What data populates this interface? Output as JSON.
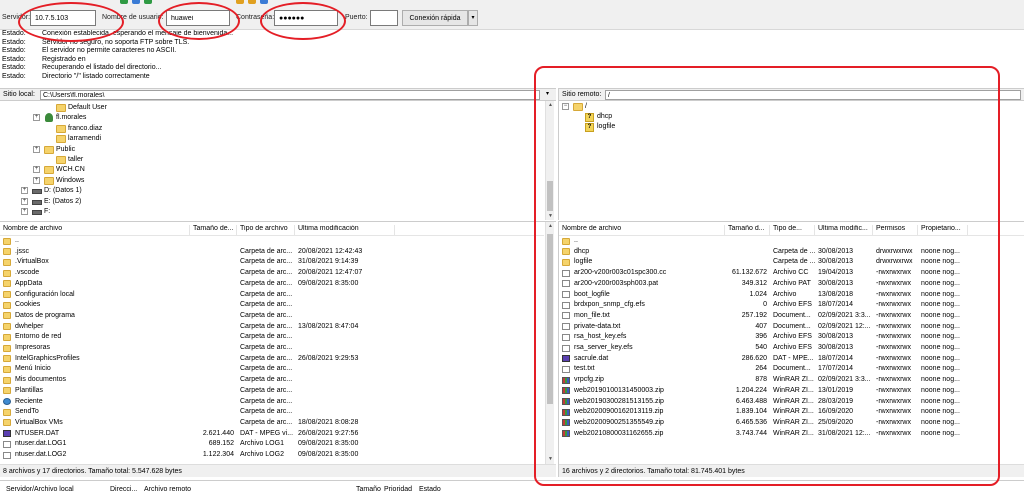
{
  "quickconnect": {
    "host_label": "Servidor:",
    "host_value": "10.7.5.103",
    "user_label": "Nombre de usuario:",
    "user_value": "huawei",
    "pass_label": "Contraseña:",
    "pass_value": "●●●●●●",
    "port_label": "Puerto:",
    "port_value": "",
    "connect_label": "Conexión rápida",
    "dropdown_label": "▾"
  },
  "log": [
    {
      "label": "Estado:",
      "msg": "Conexión establecida, esperando el mensaje de bienvenida..."
    },
    {
      "label": "Estado:",
      "msg": "Servidor no seguro, no soporta FTP sobre TLS."
    },
    {
      "label": "Estado:",
      "msg": "El servidor no permite caracteres no ASCII."
    },
    {
      "label": "Estado:",
      "msg": "Registrado en"
    },
    {
      "label": "Estado:",
      "msg": "Recuperando el listado del directorio..."
    },
    {
      "label": "Estado:",
      "msg": "Directorio \"/\" listado correctamente"
    }
  ],
  "local": {
    "path_label": "Sitio local:",
    "path_value": "C:\\Users\\fl.morales\\",
    "tree": [
      {
        "label": "Default User",
        "icon": "folder"
      },
      {
        "label": "fl.morales",
        "icon": "user"
      },
      {
        "label": "franco.diaz",
        "icon": "folder"
      },
      {
        "label": "larramendi",
        "icon": "folder"
      },
      {
        "label": "Public",
        "icon": "folder"
      },
      {
        "label": "taller",
        "icon": "folder"
      },
      {
        "label": "WCH.CN",
        "icon": "folder"
      },
      {
        "label": "Windows",
        "icon": "folder"
      },
      {
        "label": "D: (Datos 1)",
        "icon": "drive"
      },
      {
        "label": "E: (Datos 2)",
        "icon": "drive"
      },
      {
        "label": "F:",
        "icon": "drive"
      }
    ],
    "columns": [
      "Nombre de archivo",
      "Tamaño de...",
      "Tipo de archivo",
      "Última modificación"
    ],
    "files": [
      {
        "name": "..",
        "size": "",
        "type": "",
        "modified": "",
        "icon": "folder"
      },
      {
        "name": ".jssc",
        "size": "",
        "type": "Carpeta de arc...",
        "modified": "20/08/2021 12:42:43",
        "icon": "folder"
      },
      {
        "name": ".VirtualBox",
        "size": "",
        "type": "Carpeta de arc...",
        "modified": "31/08/2021 9:14:39",
        "icon": "folder"
      },
      {
        "name": ".vscode",
        "size": "",
        "type": "Carpeta de arc...",
        "modified": "20/08/2021 12:47:07",
        "icon": "folder"
      },
      {
        "name": "AppData",
        "size": "",
        "type": "Carpeta de arc...",
        "modified": "09/08/2021 8:35:00",
        "icon": "folder"
      },
      {
        "name": "Configuración local",
        "size": "",
        "type": "Carpeta de arc...",
        "modified": "",
        "icon": "folder"
      },
      {
        "name": "Cookies",
        "size": "",
        "type": "Carpeta de arc...",
        "modified": "",
        "icon": "folder"
      },
      {
        "name": "Datos de programa",
        "size": "",
        "type": "Carpeta de arc...",
        "modified": "",
        "icon": "folder"
      },
      {
        "name": "dwhelper",
        "size": "",
        "type": "Carpeta de arc...",
        "modified": "13/08/2021 8:47:04",
        "icon": "folder"
      },
      {
        "name": "Entorno de red",
        "size": "",
        "type": "Carpeta de arc...",
        "modified": "",
        "icon": "folder"
      },
      {
        "name": "Impresoras",
        "size": "",
        "type": "Carpeta de arc...",
        "modified": "",
        "icon": "folder"
      },
      {
        "name": "IntelGraphicsProfiles",
        "size": "",
        "type": "Carpeta de arc...",
        "modified": "26/08/2021 9:29:53",
        "icon": "folder"
      },
      {
        "name": "Menú Inicio",
        "size": "",
        "type": "Carpeta de arc...",
        "modified": "",
        "icon": "folder"
      },
      {
        "name": "Mis documentos",
        "size": "",
        "type": "Carpeta de arc...",
        "modified": "",
        "icon": "folder"
      },
      {
        "name": "Plantillas",
        "size": "",
        "type": "Carpeta de arc...",
        "modified": "",
        "icon": "folder"
      },
      {
        "name": "Reciente",
        "size": "",
        "type": "Carpeta de arc...",
        "modified": "",
        "icon": "globe"
      },
      {
        "name": "SendTo",
        "size": "",
        "type": "Carpeta de arc...",
        "modified": "",
        "icon": "folder"
      },
      {
        "name": "VirtualBox VMs",
        "size": "",
        "type": "Carpeta de arc...",
        "modified": "18/08/2021 8:08:28",
        "icon": "folder"
      },
      {
        "name": "NTUSER.DAT",
        "size": "2.621.440",
        "type": "DAT - MPEG vi...",
        "modified": "26/08/2021 9:27:56",
        "icon": "media"
      },
      {
        "name": "ntuser.dat.LOG1",
        "size": "689.152",
        "type": "Archivo LOG1",
        "modified": "09/08/2021 8:35:00",
        "icon": "file"
      },
      {
        "name": "ntuser.dat.LOG2",
        "size": "1.122.304",
        "type": "Archivo LOG2",
        "modified": "09/08/2021 8:35:00",
        "icon": "file"
      }
    ],
    "status": "8 archivos y 17 directorios. Tamaño total: 5.547.628 bytes"
  },
  "remote": {
    "path_label": "Sitio remoto:",
    "path_value": "/",
    "tree": [
      {
        "label": "/",
        "icon": "folder"
      },
      {
        "label": "dhcp",
        "icon": "unknown"
      },
      {
        "label": "logfile",
        "icon": "unknown"
      }
    ],
    "columns": [
      "Nombre de archivo",
      "Tamaño d...",
      "Tipo de...",
      "Última modific...",
      "Permisos",
      "Propietario..."
    ],
    "files": [
      {
        "name": "..",
        "size": "",
        "type": "",
        "modified": "",
        "perms": "",
        "owner": "",
        "icon": "folder"
      },
      {
        "name": "dhcp",
        "size": "",
        "type": "Carpeta de ...",
        "modified": "30/08/2013",
        "perms": "drwxrwxrwx",
        "owner": "noone nog...",
        "icon": "folder"
      },
      {
        "name": "logfile",
        "size": "",
        "type": "Carpeta de ...",
        "modified": "30/08/2013",
        "perms": "drwxrwxrwx",
        "owner": "noone nog...",
        "icon": "folder"
      },
      {
        "name": "ar200-v200r003c01spc300.cc",
        "size": "61.132.672",
        "type": "Archivo CC",
        "modified": "19/04/2013",
        "perms": "-rwxrwxrwx",
        "owner": "noone nog...",
        "icon": "file"
      },
      {
        "name": "ar200-v200r003sph003.pat",
        "size": "349.312",
        "type": "Archivo PAT",
        "modified": "30/08/2013",
        "perms": "-rwxrwxrwx",
        "owner": "noone nog...",
        "icon": "file"
      },
      {
        "name": "boot_logfile",
        "size": "1.024",
        "type": "Archivo",
        "modified": "13/08/2018",
        "perms": "-rwxrwxrwx",
        "owner": "noone nog...",
        "icon": "file"
      },
      {
        "name": "brdxpon_snmp_cfg.efs",
        "size": "0",
        "type": "Archivo EFS",
        "modified": "18/07/2014",
        "perms": "-rwxrwxrwx",
        "owner": "noone nog...",
        "icon": "file"
      },
      {
        "name": "mon_file.txt",
        "size": "257.192",
        "type": "Document...",
        "modified": "02/09/2021 3:3...",
        "perms": "-rwxrwxrwx",
        "owner": "noone nog...",
        "icon": "file"
      },
      {
        "name": "private-data.txt",
        "size": "407",
        "type": "Document...",
        "modified": "02/09/2021 12:...",
        "perms": "-rwxrwxrwx",
        "owner": "noone nog...",
        "icon": "file"
      },
      {
        "name": "rsa_host_key.efs",
        "size": "396",
        "type": "Archivo EFS",
        "modified": "30/08/2013",
        "perms": "-rwxrwxrwx",
        "owner": "noone nog...",
        "icon": "file"
      },
      {
        "name": "rsa_server_key.efs",
        "size": "540",
        "type": "Archivo EFS",
        "modified": "30/08/2013",
        "perms": "-rwxrwxrwx",
        "owner": "noone nog...",
        "icon": "file"
      },
      {
        "name": "sacrule.dat",
        "size": "286.620",
        "type": "DAT - MPE...",
        "modified": "18/07/2014",
        "perms": "-rwxrwxrwx",
        "owner": "noone nog...",
        "icon": "media"
      },
      {
        "name": "test.txt",
        "size": "264",
        "type": "Document...",
        "modified": "17/07/2014",
        "perms": "-rwxrwxrwx",
        "owner": "noone nog...",
        "icon": "file"
      },
      {
        "name": "vrpcfg.zip",
        "size": "878",
        "type": "WinRAR ZI...",
        "modified": "02/09/2021 3:3...",
        "perms": "-rwxrwxrwx",
        "owner": "noone nog...",
        "icon": "zip"
      },
      {
        "name": "web20190100131450003.zip",
        "size": "1.204.224",
        "type": "WinRAR ZI...",
        "modified": "13/01/2019",
        "perms": "-rwxrwxrwx",
        "owner": "noone nog...",
        "icon": "zip"
      },
      {
        "name": "web20190300281513155.zip",
        "size": "6.463.488",
        "type": "WinRAR ZI...",
        "modified": "28/03/2019",
        "perms": "-rwxrwxrwx",
        "owner": "noone nog...",
        "icon": "zip"
      },
      {
        "name": "web20200900162013119.zip",
        "size": "1.839.104",
        "type": "WinRAR ZI...",
        "modified": "16/09/2020",
        "perms": "-rwxrwxrwx",
        "owner": "noone nog...",
        "icon": "zip"
      },
      {
        "name": "web20200900251355549.zip",
        "size": "6.465.536",
        "type": "WinRAR ZI...",
        "modified": "25/09/2020",
        "perms": "-rwxrwxrwx",
        "owner": "noone nog...",
        "icon": "zip"
      },
      {
        "name": "web20210800031162655.zip",
        "size": "3.743.744",
        "type": "WinRAR ZI...",
        "modified": "31/08/2021 12:...",
        "perms": "-rwxrwxrwx",
        "owner": "noone nog...",
        "icon": "zip"
      }
    ],
    "status": "16 archivos y 2 directorios. Tamaño total: 81.745.401 bytes"
  },
  "queue": {
    "columns": [
      "Servidor/Archivo local",
      "Direcci...",
      "Archivo remoto",
      "Tamaño",
      "Prioridad",
      "Estado"
    ]
  },
  "colors": {
    "annotation": "#e41e26",
    "folder": "#f5d36b"
  }
}
